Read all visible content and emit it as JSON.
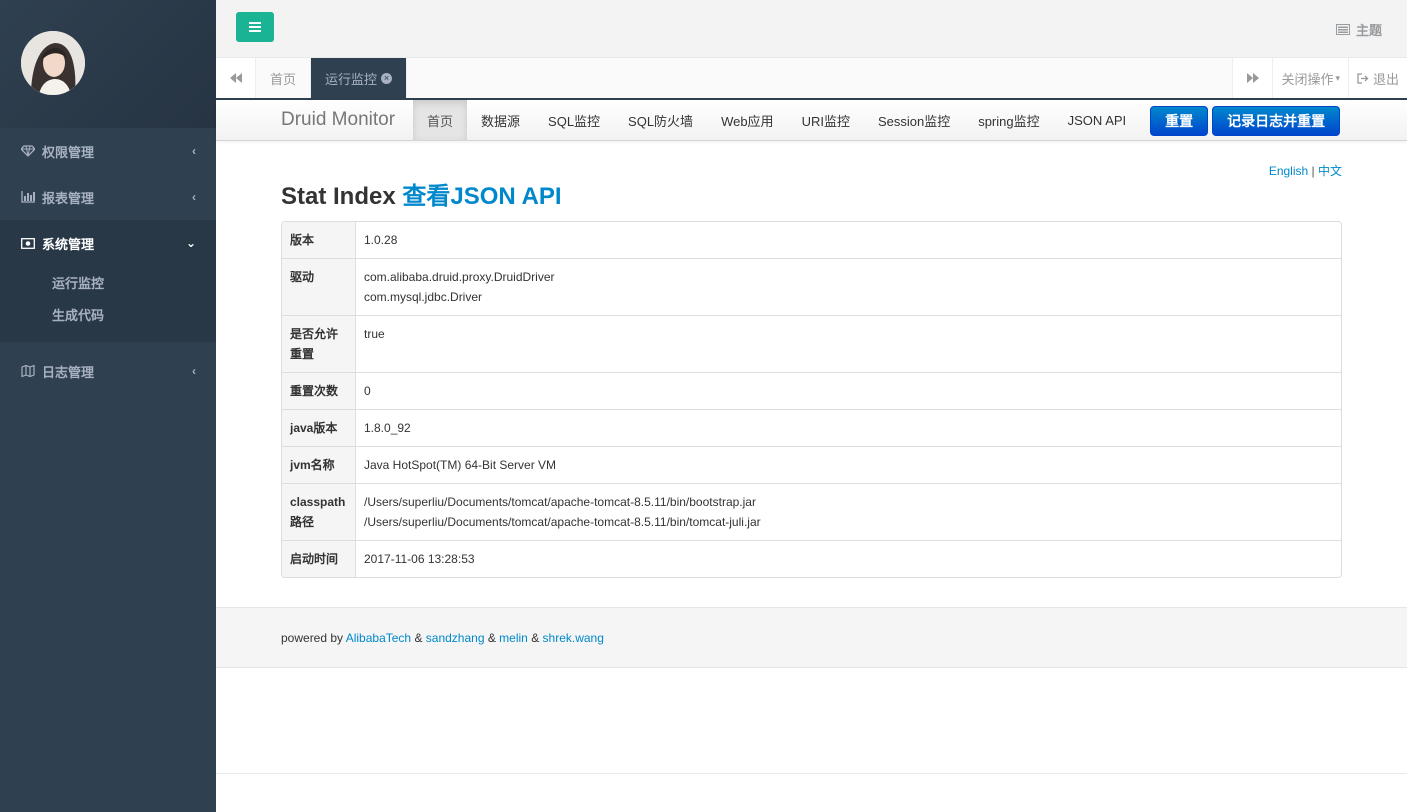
{
  "sidebar": {
    "avatar": "user-avatar",
    "menu": [
      {
        "label": "权限管理",
        "icon": "diamond-icon"
      },
      {
        "label": "报表管理",
        "icon": "bar-chart-icon"
      },
      {
        "label": "系统管理",
        "icon": "money-icon",
        "sub": [
          "运行监控",
          "生成代码"
        ]
      },
      {
        "label": "日志管理",
        "icon": "map-icon"
      }
    ]
  },
  "header": {
    "theme_label": "主题"
  },
  "tabs": {
    "items": [
      "首页",
      "运行监控"
    ],
    "close_ops": "关闭操作",
    "logout": "退出"
  },
  "druid": {
    "brand": "Druid Monitor",
    "nav": [
      "首页",
      "数据源",
      "SQL监控",
      "SQL防火墙",
      "Web应用",
      "URI监控",
      "Session监控",
      "spring监控",
      "JSON API"
    ],
    "reset_btn": "重置",
    "log_reset_btn": "记录日志并重置",
    "lang_en": "English",
    "lang_sep": " | ",
    "lang_zh": "中文",
    "title": "Stat Index",
    "title_link": "查看JSON API",
    "rows": [
      {
        "key": "版本",
        "value": "1.0.28"
      },
      {
        "key": "驱动",
        "value": "com.alibaba.druid.proxy.DruidDriver",
        "value2": "com.mysql.jdbc.Driver"
      },
      {
        "key": "是否允许重置",
        "value": "true"
      },
      {
        "key": "重置次数",
        "value": "0"
      },
      {
        "key": "java版本",
        "value": "1.8.0_92"
      },
      {
        "key": "jvm名称",
        "value": "Java HotSpot(TM) 64-Bit Server VM"
      },
      {
        "key": "classpath路径",
        "value": "/Users/superliu/Documents/tomcat/apache-tomcat-8.5.11/bin/bootstrap.jar",
        "value2": "/Users/superliu/Documents/tomcat/apache-tomcat-8.5.11/bin/tomcat-juli.jar"
      },
      {
        "key": "启动时间",
        "value": "2017-11-06 13:28:53"
      }
    ],
    "footer": {
      "powered": "powered by ",
      "link1": "AlibabaTech",
      "amp": " & ",
      "link2": "sandzhang",
      "link3": "melin",
      "link4": "shrek.wang"
    }
  }
}
